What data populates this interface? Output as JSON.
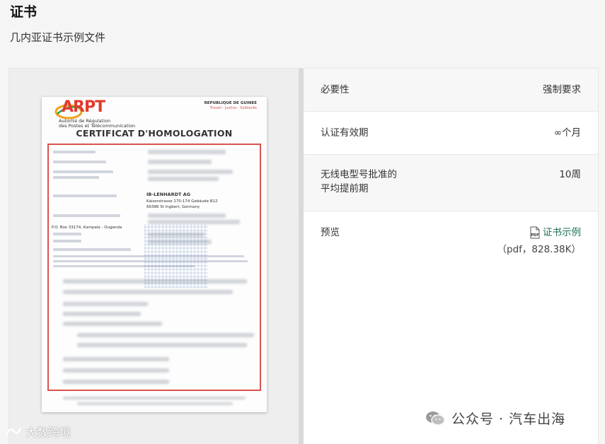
{
  "header": {
    "title": "证书",
    "subtitle": "几内亚证书示例文件"
  },
  "details": {
    "rows": [
      {
        "label": "必要性",
        "value": "强制要求"
      },
      {
        "label": "认证有效期",
        "value": "∞个月"
      },
      {
        "label": "无线电型号批准的平均提前期",
        "value": "10周"
      },
      {
        "label": "预览",
        "link_text": "证书示例",
        "file_meta": "（pdf，828.38K）"
      }
    ],
    "pdf_icon_text": "PDF"
  },
  "certificate": {
    "logo": "ARPT",
    "authority": [
      "Autorité de Régulation",
      "des Postes et Télécommunication"
    ],
    "republic": "REPUBLIQUE DE GUINEE",
    "motto": "Travail - Justice - Solidarité",
    "heading": "CERTIFICAT D'HOMOLOGATION",
    "company": "IB-LENHARDT AG",
    "address_1": "Kaiserstrasse 170-174 Gebäude B12",
    "address_2": "66386 St Ingbert, Germany",
    "po_box": "P.O. Box 33174, Kampala - Ouganda"
  },
  "watermarks": {
    "left": "大数跨境",
    "right": "公众号 · 汽车出海"
  },
  "colors": {
    "link": "#1f6f5a",
    "logo_red": "#e23a2e",
    "frame_red": "#d9534f"
  }
}
